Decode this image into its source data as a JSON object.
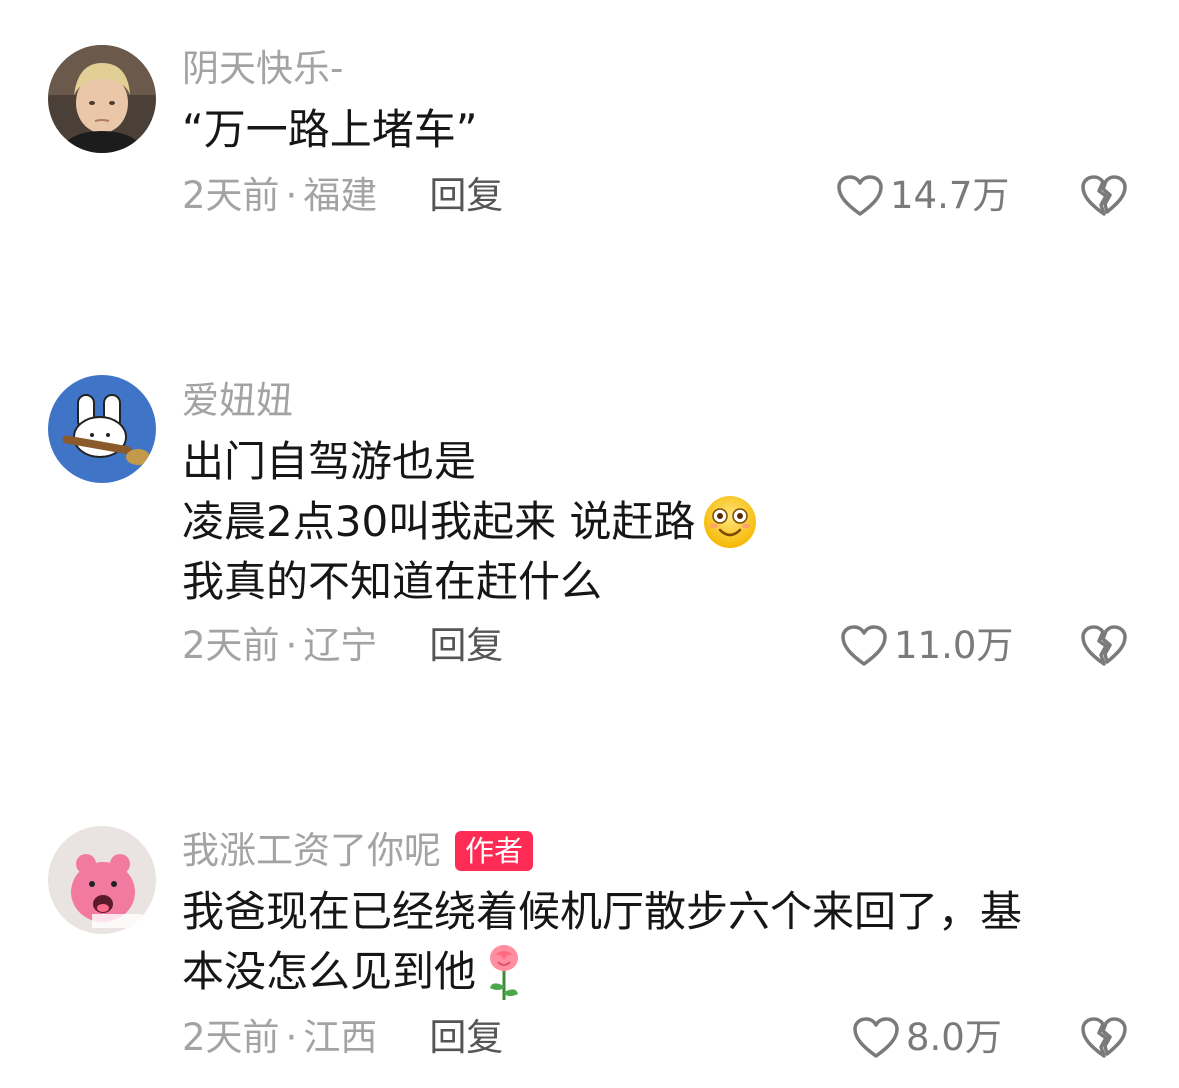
{
  "comments": [
    {
      "username": "阴天快乐-",
      "lines": [
        "“万一路上堵车”"
      ],
      "time": "2天前",
      "location": "福建",
      "reply": "回复",
      "likes": "14.7万",
      "author_badge": ""
    },
    {
      "username": "爱妞妞",
      "lines": [
        "出门自驾游也是",
        "凌晨2点30叫我起来 说赶路",
        "我真的不知道在赶什么"
      ],
      "time": "2天前",
      "location": "辽宁",
      "reply": "回复",
      "likes": "11.0万",
      "author_badge": ""
    },
    {
      "username": "我涨工资了你呢",
      "lines": [
        "我爸现在已经绕着候机厅散步六个来回了，基",
        "本没怎么见到他"
      ],
      "time": "2天前",
      "location": "江西",
      "reply": "回复",
      "likes": "8.0万",
      "author_badge": "作者"
    }
  ],
  "separator": "·",
  "colors": {
    "text_primary": "#161616",
    "text_secondary": "#a3a3a3",
    "reply_text": "#555555",
    "author_badge_bg": "#fe2c55"
  },
  "icons": {
    "like": "heart-outline-icon",
    "dislike": "broken-heart-icon",
    "emoji_2": "smile-face-emoji",
    "emoji_3": "rose-emoji"
  }
}
